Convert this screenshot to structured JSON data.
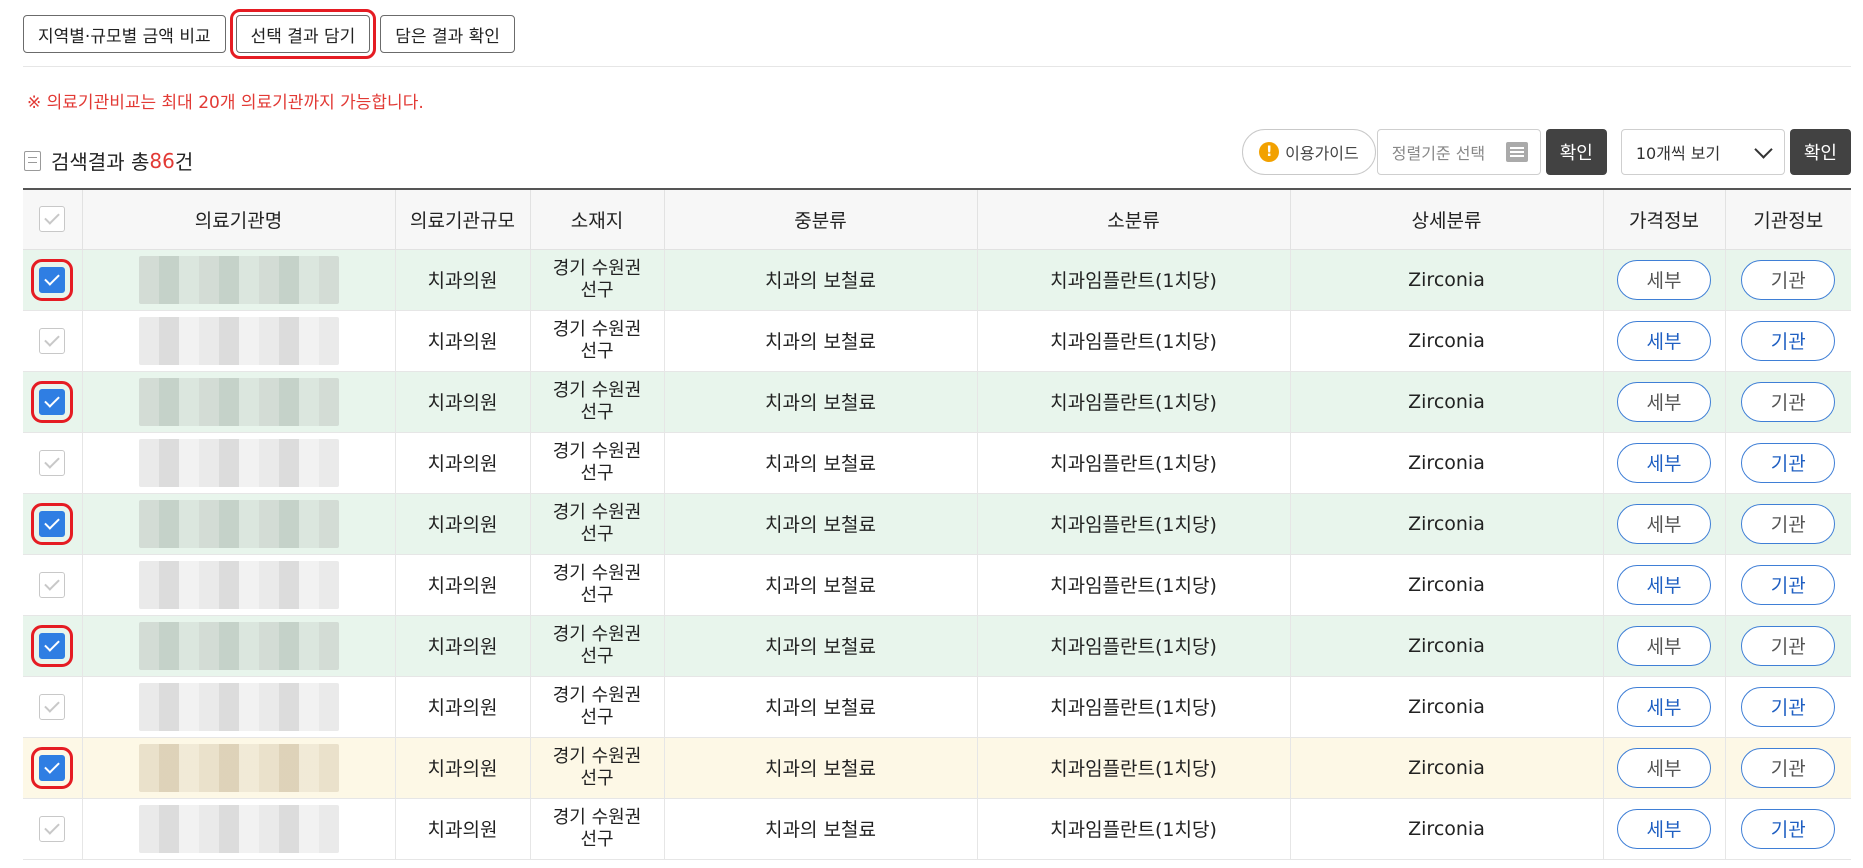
{
  "toolbar": {
    "compare_label": "지역별·규모별 금액 비교",
    "add_label": "선택 결과 담기",
    "view_label": "담은 결과 확인"
  },
  "notice": "※ 의료기관비교는 최대 20개 의료기관까지 가능합니다.",
  "result": {
    "prefix": "검색결과 총",
    "count": "86",
    "suffix": "건"
  },
  "controls": {
    "guide_icon": "!",
    "guide_label": "이용가이드",
    "sort_placeholder": "정렬기준 선택",
    "confirm_label": "확인",
    "page_size_value": "10개씩 보기",
    "confirm2_label": "확인"
  },
  "table": {
    "headers": [
      "의료기관명",
      "의료기관규모",
      "소재지",
      "중분류",
      "소분류",
      "상세분류",
      "가격정보",
      "기관정보"
    ],
    "rows": [
      {
        "scale": "치과의원",
        "loc1": "경기 수원권",
        "loc2": "선구",
        "mid": "치과의 보철료",
        "small": "치과임플란트(1치당)",
        "detail": "Zirconia",
        "price": "세부",
        "inst": "기관"
      },
      {
        "scale": "치과의원",
        "loc1": "경기 수원권",
        "loc2": "선구",
        "mid": "치과의 보철료",
        "small": "치과임플란트(1치당)",
        "detail": "Zirconia",
        "price": "세부",
        "inst": "기관"
      },
      {
        "scale": "치과의원",
        "loc1": "경기 수원권",
        "loc2": "선구",
        "mid": "치과의 보철료",
        "small": "치과임플란트(1치당)",
        "detail": "Zirconia",
        "price": "세부",
        "inst": "기관"
      },
      {
        "scale": "치과의원",
        "loc1": "경기 수원권",
        "loc2": "선구",
        "mid": "치과의 보철료",
        "small": "치과임플란트(1치당)",
        "detail": "Zirconia",
        "price": "세부",
        "inst": "기관"
      },
      {
        "scale": "치과의원",
        "loc1": "경기 수원권",
        "loc2": "선구",
        "mid": "치과의 보철료",
        "small": "치과임플란트(1치당)",
        "detail": "Zirconia",
        "price": "세부",
        "inst": "기관"
      },
      {
        "scale": "치과의원",
        "loc1": "경기 수원권",
        "loc2": "선구",
        "mid": "치과의 보철료",
        "small": "치과임플란트(1치당)",
        "detail": "Zirconia",
        "price": "세부",
        "inst": "기관"
      },
      {
        "scale": "치과의원",
        "loc1": "경기 수원권",
        "loc2": "선구",
        "mid": "치과의 보철료",
        "small": "치과임플란트(1치당)",
        "detail": "Zirconia",
        "price": "세부",
        "inst": "기관"
      },
      {
        "scale": "치과의원",
        "loc1": "경기 수원권",
        "loc2": "선구",
        "mid": "치과의 보철료",
        "small": "치과임플란트(1치당)",
        "detail": "Zirconia",
        "price": "세부",
        "inst": "기관"
      },
      {
        "scale": "치과의원",
        "loc1": "경기 수원권",
        "loc2": "선구",
        "mid": "치과의 보철료",
        "small": "치과임플란트(1치당)",
        "detail": "Zirconia",
        "price": "세부",
        "inst": "기관"
      },
      {
        "scale": "치과의원",
        "loc1": "경기 수원권",
        "loc2": "선구",
        "mid": "치과의 보철료",
        "small": "치과임플란트(1치당)",
        "detail": "Zirconia",
        "price": "세부",
        "inst": "기관"
      }
    ]
  },
  "colors": {
    "accent_red": "#e23a35",
    "check_blue": "#2f7ee3",
    "row_green": "#e8f5ec",
    "row_yellow": "#fdf8e6"
  }
}
